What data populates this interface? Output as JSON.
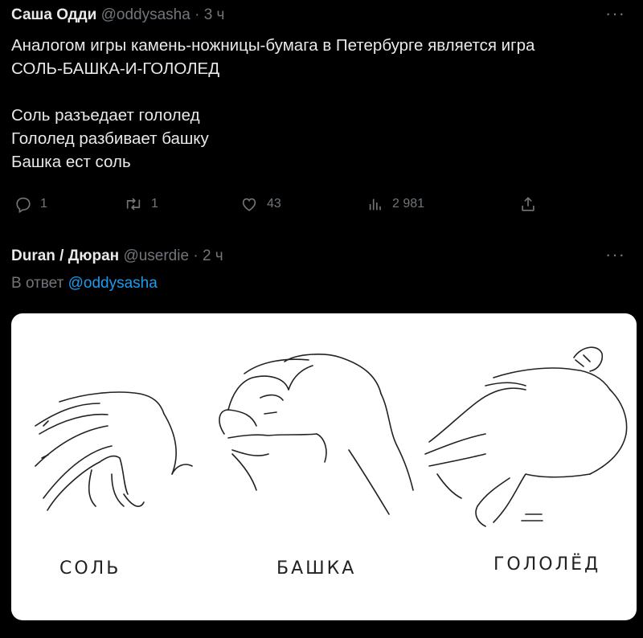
{
  "tweets": [
    {
      "author": "Саша Одди",
      "handle": "@oddysasha",
      "separator": "·",
      "time": "3 ч",
      "more": "···",
      "text": "Аналогом игры камень-ножницы-бумага в Петербурге является игра\nСОЛЬ-БАШКА-И-ГОЛОЛЕД\n\nСоль разъедает гололед\nГололед разбивает башку\nБашка ест соль",
      "actions": {
        "replies": "1",
        "retweets": "1",
        "likes": "43",
        "views": "2 981"
      }
    },
    {
      "author": "Duran / Дюран",
      "handle": "@userdie",
      "separator": "·",
      "time": "2 ч",
      "more": "···",
      "reply_prefix": "В ответ",
      "reply_to": "@oddysasha",
      "image_captions": [
        "СОЛЬ",
        "БАШКА",
        "ГОЛОЛЁД"
      ]
    }
  ],
  "icons": [
    "reply-icon",
    "retweet-icon",
    "like-icon",
    "views-icon",
    "share-icon"
  ],
  "colors": {
    "background": "#000000",
    "text": "#e7e9ea",
    "muted": "#71767b",
    "link": "#1d9bf0"
  }
}
